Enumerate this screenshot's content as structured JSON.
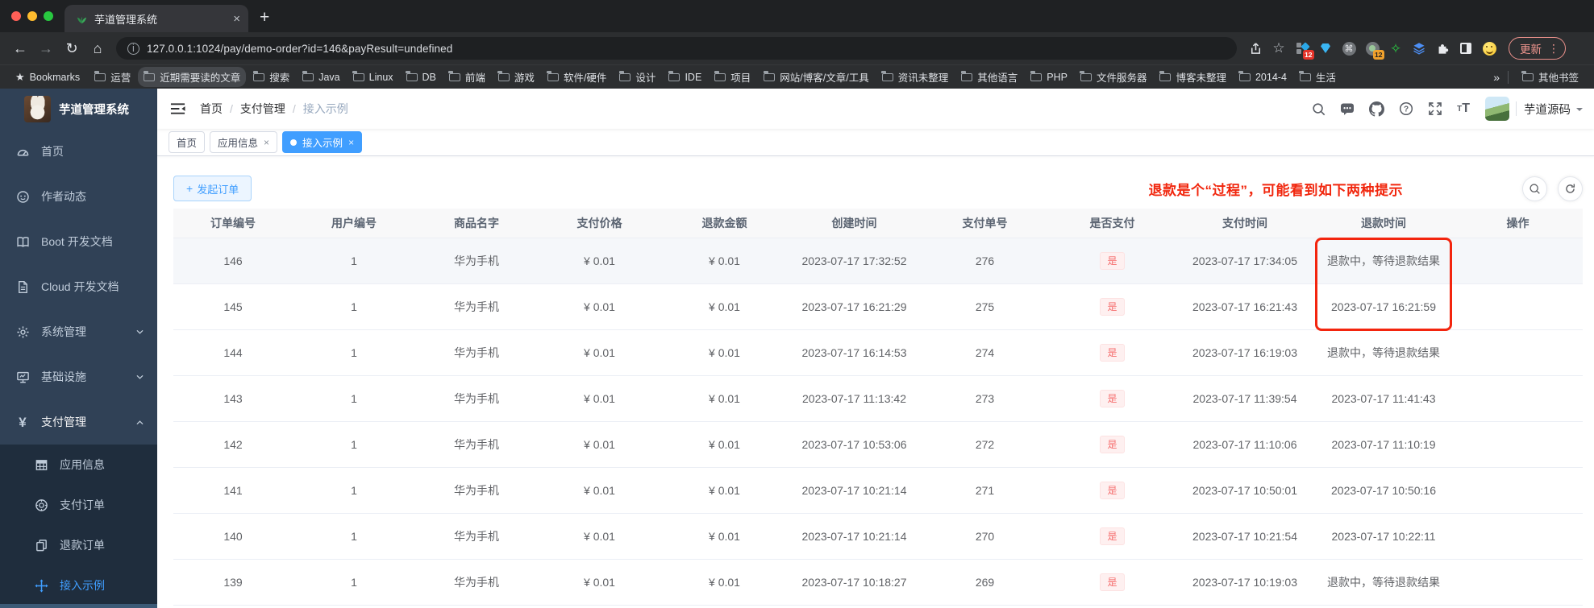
{
  "colors": {
    "accent": "#409eff",
    "danger": "#f56c6c",
    "annotation_red": "#f1270e",
    "sidebar_bg": "#304156",
    "submenu_bg": "#1f2d3d"
  },
  "browser": {
    "tab_title": "芋道管理系统",
    "tab_close": "×",
    "new_tab": "+",
    "url": "127.0.0.1:1024/pay/demo-order?id=146&payResult=undefined",
    "update_label": "更新",
    "kebab": "⋮",
    "ext_badge_blue": "12",
    "ext_badge_circle": "12",
    "bookmarks_root": "Bookmarks",
    "bookmark_items": [
      "运营",
      "近期需要读的文章",
      "搜索",
      "Java",
      "Linux",
      "DB",
      "前端",
      "游戏",
      "软件/硬件",
      "设计",
      "IDE",
      "项目",
      "网站/博客/文章/工具",
      "资讯未整理",
      "其他语言",
      "PHP",
      "文件服务器",
      "博客未整理",
      "2014-4",
      "生活"
    ],
    "bookmark_highlighted": "近期需要读的文章",
    "overflow_chevron": "»",
    "other_bookmarks": "其他书签"
  },
  "sidebar": {
    "title": "芋道管理系统",
    "items": [
      {
        "key": "home",
        "label": "首页",
        "icon": "dashboard-icon"
      },
      {
        "key": "author",
        "label": "作者动态",
        "icon": "author-icon"
      },
      {
        "key": "boot-doc",
        "label": "Boot 开发文档",
        "icon": "book-icon"
      },
      {
        "key": "cloud-doc",
        "label": "Cloud 开发文档",
        "icon": "doc-icon"
      },
      {
        "key": "system",
        "label": "系统管理",
        "icon": "gear-icon",
        "arrow": "down"
      },
      {
        "key": "infra",
        "label": "基础设施",
        "icon": "infra-icon",
        "arrow": "down"
      },
      {
        "key": "pay",
        "label": "支付管理",
        "icon": "yen-icon",
        "arrow": "up",
        "open": true
      }
    ],
    "submenu": [
      {
        "key": "app-info",
        "label": "应用信息",
        "icon": "grid-icon"
      },
      {
        "key": "pay-order",
        "label": "支付订单",
        "icon": "pay-order-icon"
      },
      {
        "key": "refund-order",
        "label": "退款订单",
        "icon": "refund-icon"
      },
      {
        "key": "demo",
        "label": "接入示例",
        "icon": "demo-icon",
        "active": true
      }
    ]
  },
  "navbar": {
    "breadcrumb": [
      "首页",
      "支付管理",
      "接入示例"
    ],
    "username": "芋道源码"
  },
  "tags": [
    {
      "label": "首页",
      "closable": false,
      "active": false
    },
    {
      "label": "应用信息",
      "closable": true,
      "active": false
    },
    {
      "label": "接入示例",
      "closable": true,
      "active": true
    }
  ],
  "content": {
    "create_label": "发起订单",
    "create_plus": "+",
    "annotation": "退款是个“过程”，可能看到如下两种提示",
    "table": {
      "headers": [
        "订单编号",
        "用户编号",
        "商品名字",
        "支付价格",
        "退款金额",
        "创建时间",
        "支付单号",
        "是否支付",
        "支付时间",
        "退款时间",
        "操作"
      ],
      "rows": [
        [
          "146",
          "1",
          "华为手机",
          "¥ 0.01",
          "¥ 0.01",
          "2023-07-17 17:32:52",
          "276",
          "是",
          "2023-07-17 17:34:05",
          "退款中，等待退款结果",
          ""
        ],
        [
          "145",
          "1",
          "华为手机",
          "¥ 0.01",
          "¥ 0.01",
          "2023-07-17 16:21:29",
          "275",
          "是",
          "2023-07-17 16:21:43",
          "2023-07-17 16:21:59",
          ""
        ],
        [
          "144",
          "1",
          "华为手机",
          "¥ 0.01",
          "¥ 0.01",
          "2023-07-17 16:14:53",
          "274",
          "是",
          "2023-07-17 16:19:03",
          "退款中，等待退款结果",
          ""
        ],
        [
          "143",
          "1",
          "华为手机",
          "¥ 0.01",
          "¥ 0.01",
          "2023-07-17 11:13:42",
          "273",
          "是",
          "2023-07-17 11:39:54",
          "2023-07-17 11:41:43",
          ""
        ],
        [
          "142",
          "1",
          "华为手机",
          "¥ 0.01",
          "¥ 0.01",
          "2023-07-17 10:53:06",
          "272",
          "是",
          "2023-07-17 11:10:06",
          "2023-07-17 11:10:19",
          ""
        ],
        [
          "141",
          "1",
          "华为手机",
          "¥ 0.01",
          "¥ 0.01",
          "2023-07-17 10:21:14",
          "271",
          "是",
          "2023-07-17 10:50:01",
          "2023-07-17 10:50:16",
          ""
        ],
        [
          "140",
          "1",
          "华为手机",
          "¥ 0.01",
          "¥ 0.01",
          "2023-07-17 10:21:14",
          "270",
          "是",
          "2023-07-17 10:21:54",
          "2023-07-17 10:22:11",
          ""
        ],
        [
          "139",
          "1",
          "华为手机",
          "¥ 0.01",
          "¥ 0.01",
          "2023-07-17 10:18:27",
          "269",
          "是",
          "2023-07-17 10:19:03",
          "退款中，等待退款结果",
          ""
        ]
      ]
    }
  }
}
